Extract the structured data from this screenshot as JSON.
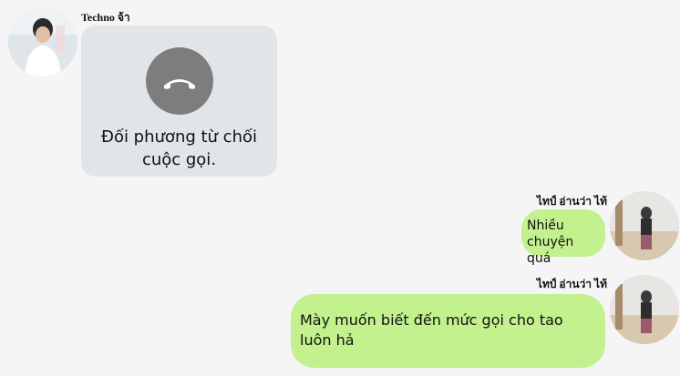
{
  "messages": [
    {
      "sender": "Techno จ้า",
      "call_status": "Đối phương từ chối cuộc gọi."
    },
    {
      "sender": "ไทป์ อ่านว่า ไท้",
      "text": "Nhiều chuyện quá"
    },
    {
      "sender": "ไทป์ อ่านว่า ไท้",
      "text": "Mày muốn biết đến mức gọi cho tao luôn hả"
    }
  ],
  "icons": {
    "call": "declined-call-icon",
    "avatar_left": "user-avatar",
    "avatar_right": "user-avatar"
  },
  "colors": {
    "background": "#f5f5f5",
    "incoming_bubble": "#e2e5e8",
    "outgoing_bubble": "#c3f18e",
    "call_icon": "#7d7d7d"
  }
}
